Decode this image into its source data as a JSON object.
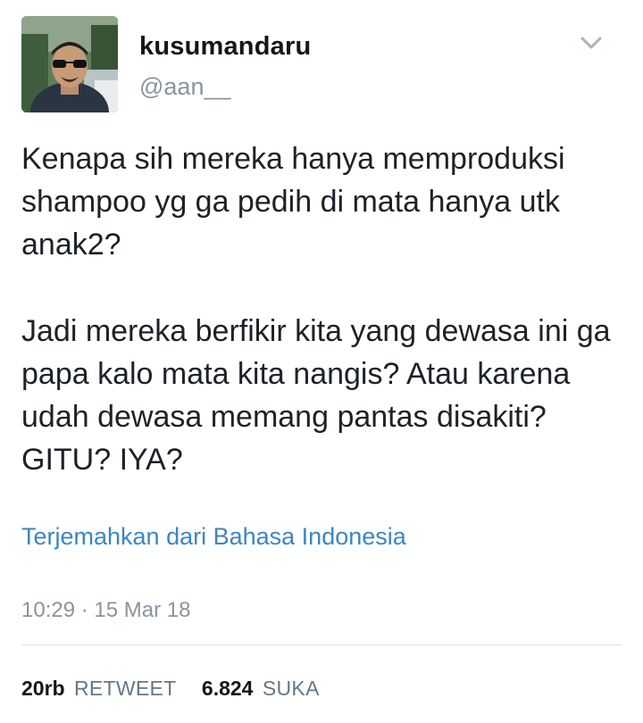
{
  "tweet": {
    "display_name": "kusumandaru",
    "handle": "@aan__",
    "paragraphs": [
      "Kenapa sih mereka hanya memproduksi shampoo yg ga pedih di mata hanya utk anak2?",
      "Jadi mereka berfikir kita yang dewasa ini ga papa kalo mata kita nangis? Atau karena udah dewasa memang pantas disakiti? GITU? IYA?"
    ],
    "translate_label": "Terjemahkan dari Bahasa Indonesia",
    "timestamp": "10:29 · 15 Mar 18",
    "retweets": {
      "count": "20rb",
      "label": "RETWEET"
    },
    "likes": {
      "count": "6.824",
      "label": "SUKA"
    }
  },
  "icons": {
    "menu": "chevron-down-icon",
    "avatar": "profile-photo"
  },
  "colors": {
    "link": "#3b86c4",
    "secondary_text": "#8a949c",
    "primary_text": "#1c2227",
    "divider": "#dfe3e6"
  }
}
